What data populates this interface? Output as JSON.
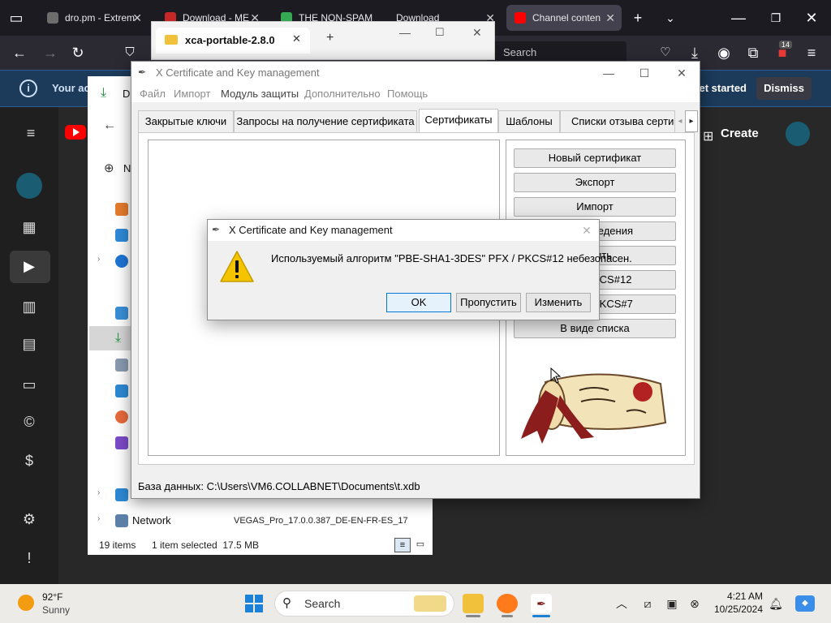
{
  "browser": {
    "tabs": [
      {
        "title": "dro.pm - Extrem",
        "favicon_color": "#6d6d6d"
      },
      {
        "title": "Download - ME",
        "favicon_color": "#c62828"
      },
      {
        "title": "THE NON-SPAM",
        "favicon_color": "#34a853"
      },
      {
        "title": "Download",
        "favicon_color": "#2b2a33"
      },
      {
        "title": "Channel conten",
        "favicon_color": "#ff0000"
      }
    ],
    "url_placeholder": "Search",
    "extensions_badge": "14"
  },
  "notification": {
    "text": "Your ac",
    "get_started": "et started",
    "dismiss": "Dismiss"
  },
  "youtube": {
    "create_label": "Create"
  },
  "explorer": {
    "tab_title": "xca-portable-2.8.0",
    "side_new": "N",
    "network": "Network",
    "vegas_file": "VEGAS_Pro_17.0.0.387_DE-EN-FR-ES_17",
    "status_items": "19 items",
    "status_selected": "1 item selected  17.5 MB",
    "address_letter": "D"
  },
  "xca": {
    "title": "X Certificate and Key management",
    "menu": [
      {
        "label": "Файл",
        "enabled": false
      },
      {
        "label": "Импорт",
        "enabled": false
      },
      {
        "label": "Модуль защиты",
        "enabled": true
      },
      {
        "label": "Дополнительно",
        "enabled": false
      },
      {
        "label": "Помощь",
        "enabled": false
      }
    ],
    "tabs": [
      "Закрытые ключи",
      "Запросы на получение сертификата",
      "Сертификаты",
      "Шаблоны",
      "Списки отзыва сертиф"
    ],
    "active_tab": "Сертификаты",
    "buttons": [
      "Новый сертификат",
      "Экспорт",
      "Импорт",
      "ведения",
      "ить",
      "KCS#12",
      "PKCS#7",
      "В виде списка"
    ],
    "status": "База данных: C:\\Users\\VM6.COLLABNET\\Documents\\t.xdb"
  },
  "dialog": {
    "title": "X Certificate and Key management",
    "message": "Используемый алгоритм \"PBE-SHA1-3DES\" PFX / PKCS#12 небезопасен.",
    "buttons": [
      "OK",
      "Пропустить",
      "Изменить"
    ]
  },
  "taskbar": {
    "temperature": "92°F",
    "weather": "Sunny",
    "search_placeholder": "Search",
    "time": "4:21 AM",
    "date": "10/25/2024"
  },
  "colors": {
    "accent_blue": "#0078d7",
    "youtube_red": "#ff0000",
    "warning_yellow": "#f5c400"
  }
}
